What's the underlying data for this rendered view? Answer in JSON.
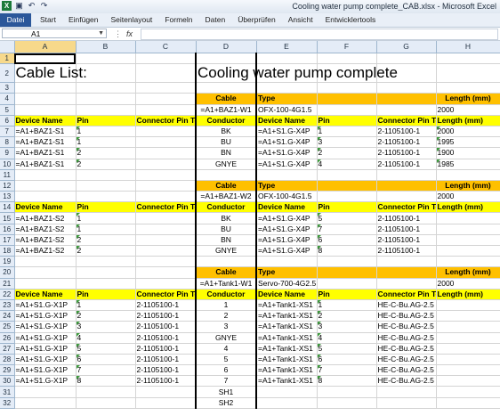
{
  "window": {
    "title": "Cooling water pump complete_CAB.xlsx - Microsoft Excel"
  },
  "qat": {
    "icons": [
      "excel-icon",
      "save-icon",
      "undo-icon",
      "redo-icon"
    ]
  },
  "ribbon": {
    "file": "Datei",
    "tabs": [
      "Start",
      "Einfügen",
      "Seitenlayout",
      "Formeln",
      "Daten",
      "Überprüfen",
      "Ansicht",
      "Entwicklertools"
    ]
  },
  "formula_bar": {
    "name_box": "A1",
    "fx": "fx",
    "value": ""
  },
  "columns": [
    "A",
    "B",
    "C",
    "D",
    "E",
    "F",
    "G",
    "H"
  ],
  "rows": [
    {
      "n": "1",
      "cells": [
        "",
        "",
        "",
        "",
        "",
        "",
        "",
        ""
      ]
    },
    {
      "n": "2",
      "title": true,
      "cells": [
        "Cable List:",
        "",
        "",
        "Cooling water pump complete",
        "",
        "",
        "",
        ""
      ]
    },
    {
      "n": "3",
      "cells": [
        "",
        "",
        "",
        "",
        "",
        "",
        "",
        ""
      ]
    },
    {
      "n": "4",
      "style": "cablehead",
      "cells": [
        "",
        "",
        "",
        "Cable",
        "Type",
        "",
        "",
        "Length (mm)"
      ]
    },
    {
      "n": "5",
      "style": "cableval",
      "cells": [
        "",
        "",
        "",
        "=A1+BAZ1-W1",
        "OFX-100-4G1.5",
        "",
        "",
        "2000"
      ]
    },
    {
      "n": "6",
      "style": "colhead",
      "cells": [
        "Device Name",
        "Pin",
        "Connector Pin Te",
        "Conductor",
        "Device Name",
        "Pin",
        "Connector Pin Te",
        "Length (mm)"
      ]
    },
    {
      "n": "7",
      "cells": [
        "=A1+BAZ1-S1",
        "1",
        "",
        "BK",
        "=A1+S1.G-X4P",
        "1",
        "2-1105100-1",
        "2000"
      ]
    },
    {
      "n": "8",
      "cells": [
        "=A1+BAZ1-S1",
        "1",
        "",
        "BU",
        "=A1+S1.G-X4P",
        "3",
        "2-1105100-1",
        "1995"
      ]
    },
    {
      "n": "9",
      "cells": [
        "=A1+BAZ1-S1",
        "2",
        "",
        "BN",
        "=A1+S1.G-X4P",
        "2",
        "2-1105100-1",
        "1900"
      ]
    },
    {
      "n": "10",
      "cells": [
        "=A1+BAZ1-S1",
        "2",
        "",
        "GNYE",
        "=A1+S1.G-X4P",
        "4",
        "2-1105100-1",
        "1985"
      ]
    },
    {
      "n": "11",
      "cells": [
        "",
        "",
        "",
        "",
        "",
        "",
        "",
        ""
      ]
    },
    {
      "n": "12",
      "style": "cablehead",
      "cells": [
        "",
        "",
        "",
        "Cable",
        "Type",
        "",
        "",
        "Length (mm)"
      ]
    },
    {
      "n": "13",
      "style": "cableval",
      "cells": [
        "",
        "",
        "",
        "=A1+BAZ1-W2",
        "OFX-100-4G1.5",
        "",
        "",
        "2000"
      ]
    },
    {
      "n": "14",
      "style": "colhead",
      "cells": [
        "Device Name",
        "Pin",
        "Connector Pin Te",
        "Conductor",
        "Device Name",
        "Pin",
        "Connector Pin Te",
        "Length (mm)"
      ]
    },
    {
      "n": "15",
      "cells": [
        "=A1+BAZ1-S2",
        "1",
        "",
        "BK",
        "=A1+S1.G-X4P",
        "5",
        "2-1105100-1",
        ""
      ]
    },
    {
      "n": "16",
      "cells": [
        "=A1+BAZ1-S2",
        "1",
        "",
        "BU",
        "=A1+S1.G-X4P",
        "7",
        "2-1105100-1",
        ""
      ]
    },
    {
      "n": "17",
      "cells": [
        "=A1+BAZ1-S2",
        "2",
        "",
        "BN",
        "=A1+S1.G-X4P",
        "6",
        "2-1105100-1",
        ""
      ]
    },
    {
      "n": "18",
      "cells": [
        "=A1+BAZ1-S2",
        "2",
        "",
        "GNYE",
        "=A1+S1.G-X4P",
        "8",
        "2-1105100-1",
        ""
      ]
    },
    {
      "n": "19",
      "cells": [
        "",
        "",
        "",
        "",
        "",
        "",
        "",
        ""
      ]
    },
    {
      "n": "20",
      "style": "cablehead",
      "cells": [
        "",
        "",
        "",
        "Cable",
        "Type",
        "",
        "",
        "Length (mm)"
      ]
    },
    {
      "n": "21",
      "style": "cableval",
      "cells": [
        "",
        "",
        "",
        "=A1+Tank1-W1",
        "Servo-700-4G2.5",
        "",
        "",
        "2000"
      ]
    },
    {
      "n": "22",
      "style": "colhead",
      "cells": [
        "Device Name",
        "Pin",
        "Connector Pin Te",
        "Conductor",
        "Device Name",
        "Pin",
        "Connector Pin Te",
        "Length (mm)"
      ]
    },
    {
      "n": "23",
      "cells": [
        "=A1+S1.G-X1P",
        "1",
        "2-1105100-1",
        "1",
        "=A1+Tank1-XS1",
        "1",
        "HE-C-Bu.AG-2.5",
        ""
      ]
    },
    {
      "n": "24",
      "cells": [
        "=A1+S1.G-X1P",
        "2",
        "2-1105100-1",
        "2",
        "=A1+Tank1-XS1",
        "2",
        "HE-C-Bu.AG-2.5",
        ""
      ]
    },
    {
      "n": "25",
      "cells": [
        "=A1+S1.G-X1P",
        "3",
        "2-1105100-1",
        "3",
        "=A1+Tank1-XS1",
        "3",
        "HE-C-Bu.AG-2.5",
        ""
      ]
    },
    {
      "n": "26",
      "cells": [
        "=A1+S1.G-X1P",
        "4",
        "2-1105100-1",
        "GNYE",
        "=A1+Tank1-XS1",
        "4",
        "HE-C-Bu.AG-2.5",
        ""
      ]
    },
    {
      "n": "27",
      "cells": [
        "=A1+S1.G-X1P",
        "5",
        "2-1105100-1",
        "4",
        "=A1+Tank1-XS1",
        "5",
        "HE-C-Bu.AG-2.5",
        ""
      ]
    },
    {
      "n": "28",
      "cells": [
        "=A1+S1.G-X1P",
        "6",
        "2-1105100-1",
        "5",
        "=A1+Tank1-XS1",
        "6",
        "HE-C-Bu.AG-2.5",
        ""
      ]
    },
    {
      "n": "29",
      "cells": [
        "=A1+S1.G-X1P",
        "7",
        "2-1105100-1",
        "6",
        "=A1+Tank1-XS1",
        "7",
        "HE-C-Bu.AG-2.5",
        ""
      ]
    },
    {
      "n": "30",
      "cells": [
        "=A1+S1.G-X1P",
        "8",
        "2-1105100-1",
        "7",
        "=A1+Tank1-XS1",
        "8",
        "HE-C-Bu.AG-2.5",
        ""
      ]
    },
    {
      "n": "31",
      "cells": [
        "",
        "",
        "",
        "SH1",
        "",
        "",
        "",
        ""
      ]
    },
    {
      "n": "32",
      "cells": [
        "",
        "",
        "",
        "SH2",
        "",
        "",
        "",
        ""
      ]
    }
  ],
  "colors": {
    "cable_header": "#ffc000",
    "column_header": "#ffff00",
    "error_marker": "#3c9a3c"
  }
}
